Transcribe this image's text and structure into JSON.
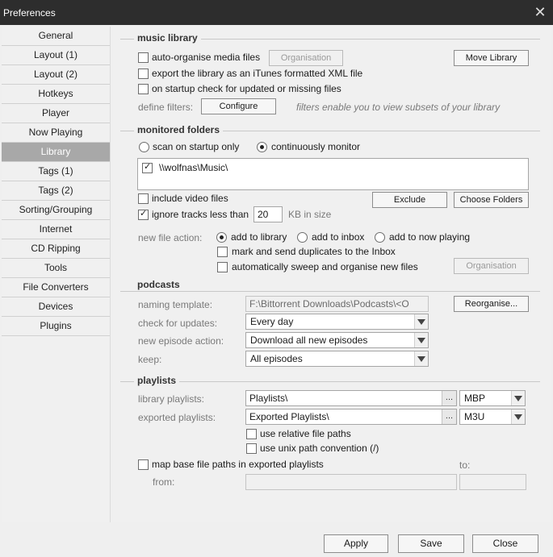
{
  "window": {
    "title": "Preferences",
    "close_glyph": "✕"
  },
  "sidebar": {
    "items": [
      {
        "label": "General"
      },
      {
        "label": "Layout (1)"
      },
      {
        "label": "Layout (2)"
      },
      {
        "label": "Hotkeys"
      },
      {
        "label": "Player"
      },
      {
        "label": "Now Playing"
      },
      {
        "label": "Library"
      },
      {
        "label": "Tags (1)"
      },
      {
        "label": "Tags (2)"
      },
      {
        "label": "Sorting/Grouping"
      },
      {
        "label": "Internet"
      },
      {
        "label": "CD Ripping"
      },
      {
        "label": "Tools"
      },
      {
        "label": "File Converters"
      },
      {
        "label": "Devices"
      },
      {
        "label": "Plugins"
      }
    ],
    "active": "Library"
  },
  "music_library": {
    "heading": "music library",
    "auto_organise": "auto-organise media files",
    "organisation_btn": "Organisation",
    "move_library_btn": "Move Library",
    "export_itunes": "export the library as an iTunes formatted XML file",
    "startup_check": "on startup check for updated or missing files",
    "define_filters": "define filters:",
    "configure_btn": "Configure",
    "filters_hint": "filters enable you to view subsets of your library"
  },
  "monitored": {
    "heading": "monitored folders",
    "scan_startup": "scan on startup only",
    "continuous": "continuously monitor",
    "folders": [
      "\\\\wolfnas\\Music\\"
    ],
    "include_video": "include video files",
    "ignore_tracks": "ignore tracks less than",
    "kb_value": "20",
    "kb_suffix": "KB in size",
    "exclude_btn": "Exclude",
    "choose_folders_btn": "Choose Folders",
    "new_file_action": "new file action:",
    "add_library": "add to library",
    "add_inbox": "add to inbox",
    "add_now_playing": "add to now playing",
    "mark_duplicates": "mark and send duplicates to the Inbox",
    "auto_sweep": "automatically sweep and organise new files",
    "organisation_btn": "Organisation"
  },
  "podcasts": {
    "heading": "podcasts",
    "naming_label": "naming template:",
    "naming_value": "F:\\Bittorrent Downloads\\Podcasts\\<O",
    "reorganise_btn": "Reorganise...",
    "check_label": "check for updates:",
    "check_value": "Every day",
    "episode_label": "new episode action:",
    "episode_value": "Download all new episodes",
    "keep_label": "keep:",
    "keep_value": "All episodes"
  },
  "playlists": {
    "heading": "playlists",
    "library_label": "library playlists:",
    "library_value": "Playlists\\",
    "library_fmt": "MBP",
    "exported_label": "exported playlists:",
    "exported_value": "Exported Playlists\\",
    "exported_fmt": "M3U",
    "dots": "...",
    "relative": "use relative file paths",
    "unix": "use unix path convention (/)",
    "map_base": "map base file paths in exported playlists",
    "to_label": "to:",
    "from_label": "from:"
  },
  "footer": {
    "apply": "Apply",
    "save": "Save",
    "close": "Close"
  }
}
